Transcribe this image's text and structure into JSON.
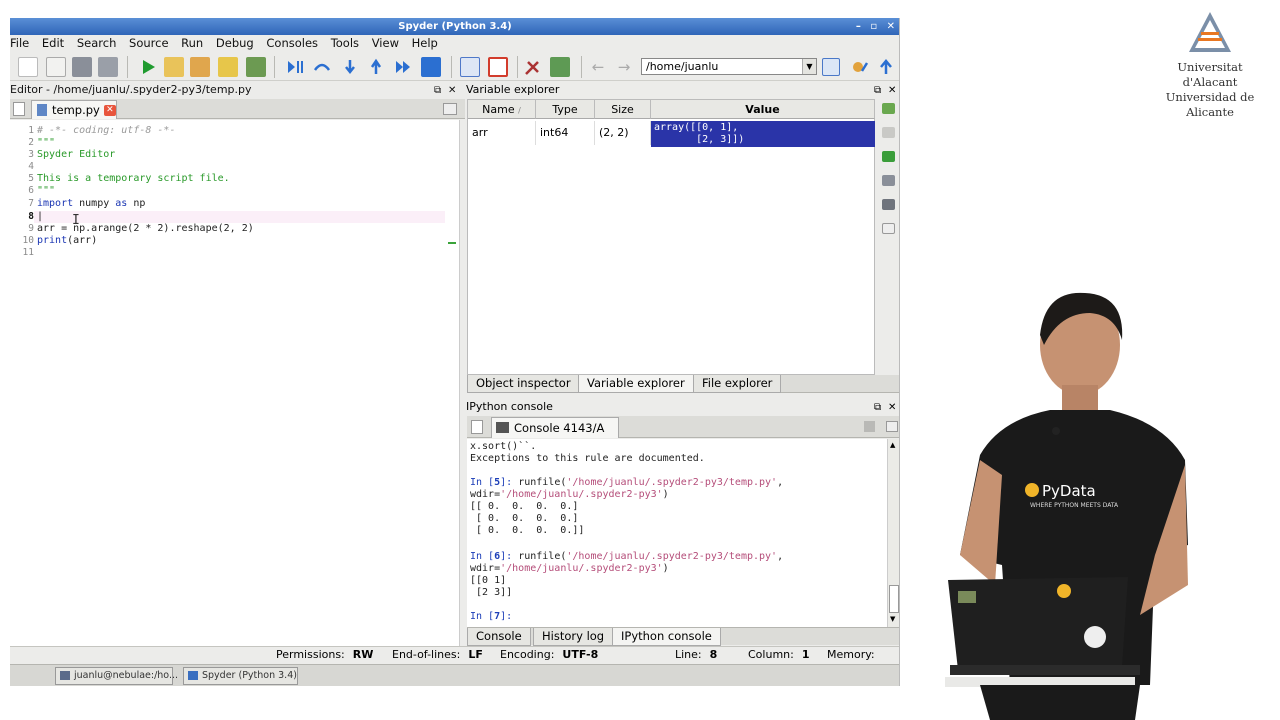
{
  "window": {
    "title": "Spyder (Python 3.4)"
  },
  "menu": [
    "File",
    "Edit",
    "Search",
    "Source",
    "Run",
    "Debug",
    "Consoles",
    "Tools",
    "View",
    "Help"
  ],
  "toolbar": {
    "path": "/home/juanlu"
  },
  "editor": {
    "header": "Editor - /home/juanlu/.spyder2-py3/temp.py",
    "tab": "temp.py",
    "current_line": 8,
    "breakpoint_line": 9
  },
  "variable_explorer": {
    "header": "Variable explorer",
    "columns": [
      "Name",
      "Type",
      "Size",
      "Value"
    ],
    "rows": [
      {
        "name": "arr",
        "type": "int64",
        "size": "(2, 2)",
        "value": "array([[0, 1],\n       [2, 3]])"
      }
    ],
    "tabs": [
      "Object inspector",
      "Variable explorer",
      "File explorer"
    ],
    "active_tab": "Variable explorer"
  },
  "ipython": {
    "header": "IPython console",
    "tab": "Console 4143/A",
    "bottom_tabs": [
      "Console",
      "History log",
      "IPython console"
    ],
    "active_tab": "IPython console"
  },
  "status": {
    "permissions_label": "Permissions:",
    "permissions_value": "RW",
    "eol_label": "End-of-lines:",
    "eol_value": "LF",
    "encoding_label": "Encoding:",
    "encoding_value": "UTF-8",
    "line_label": "Line:",
    "line_value": "8",
    "column_label": "Column:",
    "column_value": "1",
    "memory_label": "Memory:"
  },
  "taskbar": [
    "juanlu@nebulae:/ho...",
    "Spyder (Python 3.4)"
  ],
  "university": {
    "line1": "Universitat d'Alacant",
    "line2": "Universidad de Alicante"
  },
  "presenter_shirt": {
    "brand": "PyData",
    "tagline": "WHERE PYTHON MEETS DATA"
  },
  "colors": {
    "selection": "#2a34a8",
    "titlebar": "#2f65b8",
    "breakpoint": "#b3203a",
    "string": "#2a9a2a",
    "keyword": "#1b36b3"
  }
}
